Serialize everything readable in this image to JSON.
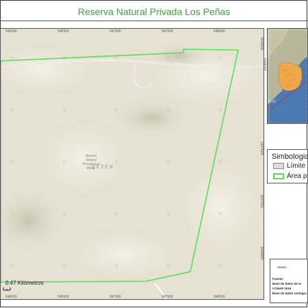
{
  "title": "Reserva Natural Privada Los Peñas",
  "map": {
    "x_ticks": [
      "546000",
      "546500",
      "547000",
      "547500",
      "548000"
    ],
    "y_ticks": [
      "1648000",
      "1647500",
      "1647000",
      "1646500"
    ],
    "place_label": "PETÉN",
    "reserve_label_lines": [
      "Reserva",
      "Natural",
      "Privada Los",
      "Peñas"
    ],
    "scale_text": "0.47 Kilómetros",
    "boundary_color": "#55e055",
    "terrain_color": "#e8e4d6"
  },
  "inset": {
    "side_label": "1648000",
    "small_label": "0.22",
    "water_color": "#4a7ab0",
    "highlight_color": "#f0a64a"
  },
  "legend": {
    "title": "Simbologia",
    "items": [
      {
        "label": "Límite",
        "swatch_fill": "#dcdcdc",
        "swatch_border": "#888888"
      },
      {
        "label": "Área pr",
        "swatch_fill": "#ffffff",
        "swatch_border": "#55e055"
      }
    ]
  },
  "info": {
    "heading": "Sistem",
    "source_label": "Fuente:",
    "line1": "Base de datos de la",
    "line2": "CONAP 2016",
    "line3": "Base de datos cartogra"
  }
}
